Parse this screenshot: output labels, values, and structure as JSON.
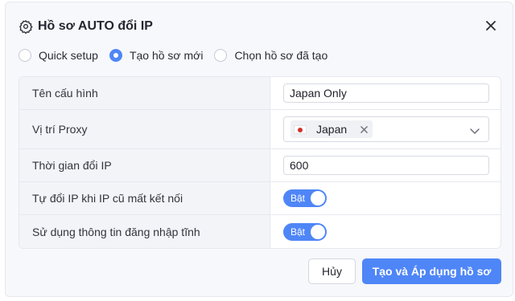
{
  "dialog": {
    "title": "Hồ sơ AUTO đổi IP",
    "title_icon": "gear-icon",
    "close_icon": "close-icon"
  },
  "mode_options": [
    {
      "label": "Quick setup",
      "selected": false
    },
    {
      "label": "Tạo hồ sơ mới",
      "selected": true
    },
    {
      "label": "Chọn hồ sơ đã tạo",
      "selected": false
    }
  ],
  "form": {
    "config_name": {
      "label": "Tên cấu hình",
      "value": "Japan Only"
    },
    "proxy_location": {
      "label": "Vị trí Proxy",
      "selected_tag": "Japan",
      "tag_icon": "japan-flag-icon"
    },
    "ip_change_time": {
      "label": "Thời gian đổi IP",
      "value": "600"
    },
    "auto_change_on_disconnect": {
      "label": "Tự đổi IP khi IP cũ mất kết nối",
      "toggle_text": "Bật",
      "on": true
    },
    "use_static_login": {
      "label": "Sử dụng thông tin đăng nhập tĩnh",
      "toggle_text": "Bật",
      "on": true
    }
  },
  "footer": {
    "cancel_label": "Hủy",
    "primary_label": "Tạo và Áp dụng hồ sơ"
  },
  "colors": {
    "accent": "#4f86f7",
    "label_bg": "#f3f4f8",
    "border": "#e6e8ef"
  }
}
